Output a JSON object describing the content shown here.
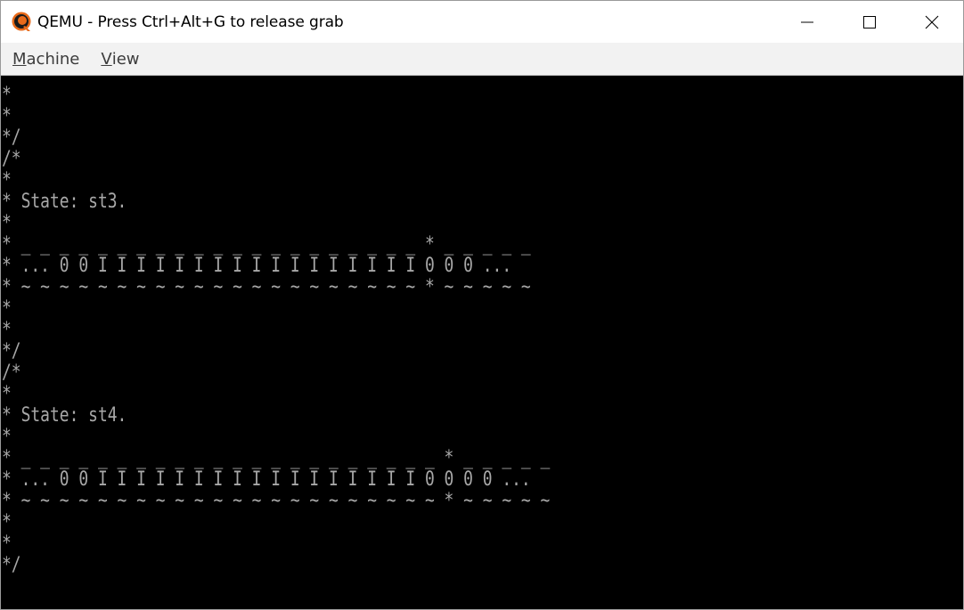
{
  "window": {
    "title": "QEMU - Press Ctrl+Alt+G to release grab"
  },
  "menu": {
    "machine_first": "M",
    "machine_rest": "achine",
    "view_first": "V",
    "view_rest": "iew"
  },
  "terminal": {
    "lines": [
      "* ~ ~ ~ ~ ~ ~ ~ ~ ~ ~ ~ ~ ~ ~ ~ ~ ~ ~ ~ ~ * ~ ~ ~ ~ ~",
      "*",
      "*",
      "*/",
      "/*",
      "*",
      "* State: st3.",
      "*",
      "* _ _ _ _ _ _ _ _ _ _ _ _ _ _ _ _ _ _ _ _ _ * _ _ _ _ _",
      "* ... 0 0 I I I I I I I I I I I I I I I I I 0 0 0 ...",
      "* ~ ~ ~ ~ ~ ~ ~ ~ ~ ~ ~ ~ ~ ~ ~ ~ ~ ~ ~ ~ ~ * ~ ~ ~ ~ ~",
      "*",
      "*",
      "*/",
      "/*",
      "*",
      "* State: st4.",
      "*",
      "* _ _ _ _ _ _ _ _ _ _ _ _ _ _ _ _ _ _ _ _ _ _ * _ _ _ _ _",
      "* ... 0 0 I I I I I I I I I I I I I I I I I 0 0 0 0 ...",
      "* ~ ~ ~ ~ ~ ~ ~ ~ ~ ~ ~ ~ ~ ~ ~ ~ ~ ~ ~ ~ ~ ~ * ~ ~ ~ ~ ~",
      "*",
      "*",
      "*/"
    ]
  },
  "colors": {
    "terminal_bg": "#000000",
    "terminal_fg": "#a8a8a8",
    "titlebar_bg": "#ffffff",
    "menubar_bg": "#f2f2f2"
  },
  "icons": {
    "app": "qemu-logo-icon",
    "minimize": "minimize-icon",
    "maximize": "maximize-icon",
    "close": "close-icon"
  }
}
